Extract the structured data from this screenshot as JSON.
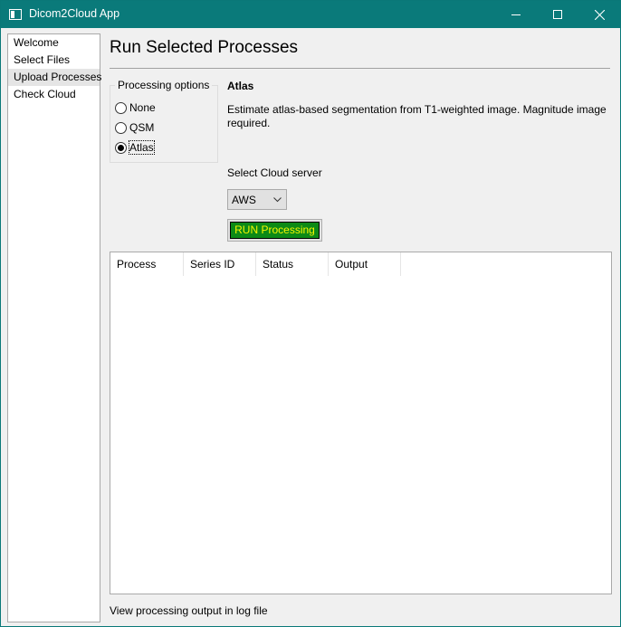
{
  "window": {
    "title": "Dicom2Cloud App",
    "accent": "#0a7a7a"
  },
  "sidebar": {
    "items": [
      {
        "label": "Welcome"
      },
      {
        "label": "Select Files"
      },
      {
        "label": "Upload Processes",
        "selected": true
      },
      {
        "label": "Check Cloud"
      }
    ]
  },
  "main": {
    "title": "Run Selected Processes",
    "processing_options": {
      "title": "Processing options",
      "options": [
        {
          "label": "None",
          "checked": false
        },
        {
          "label": "QSM",
          "checked": false
        },
        {
          "label": "Atlas",
          "checked": true
        }
      ]
    },
    "description": {
      "title": "Atlas",
      "text": "Estimate atlas-based segmentation from T1-weighted image. Magnitude image required."
    },
    "cloud": {
      "label": "Select Cloud server",
      "selected": "AWS"
    },
    "run_button": {
      "label": "RUN Processing",
      "bg": "#0c8a16",
      "fg": "#f6f600"
    },
    "table": {
      "columns": [
        "Process",
        "Series ID",
        "Status",
        "Output"
      ]
    },
    "status_text": "View processing output in log file"
  }
}
